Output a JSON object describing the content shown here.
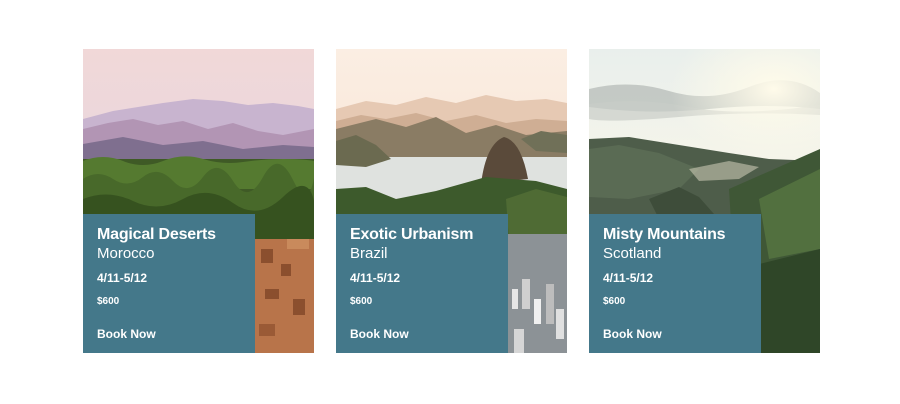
{
  "cards": [
    {
      "title": "Magical Deserts",
      "location": "Morocco",
      "dates": "4/11-5/12",
      "price": "$600",
      "cta": "Book Now",
      "image": "desert-oasis-mountains"
    },
    {
      "title": "Exotic Urbanism",
      "location": "Brazil",
      "dates": "4/11-5/12",
      "price": "$600",
      "cta": "Book Now",
      "image": "rio-sugarloaf-bay"
    },
    {
      "title": "Misty Mountains",
      "location": "Scotland",
      "dates": "4/11-5/12",
      "price": "$600",
      "cta": "Book Now",
      "image": "misty-highland-valley"
    }
  ],
  "colors": {
    "panel": "#44788a",
    "text": "#ffffff",
    "background": "#ffffff"
  }
}
